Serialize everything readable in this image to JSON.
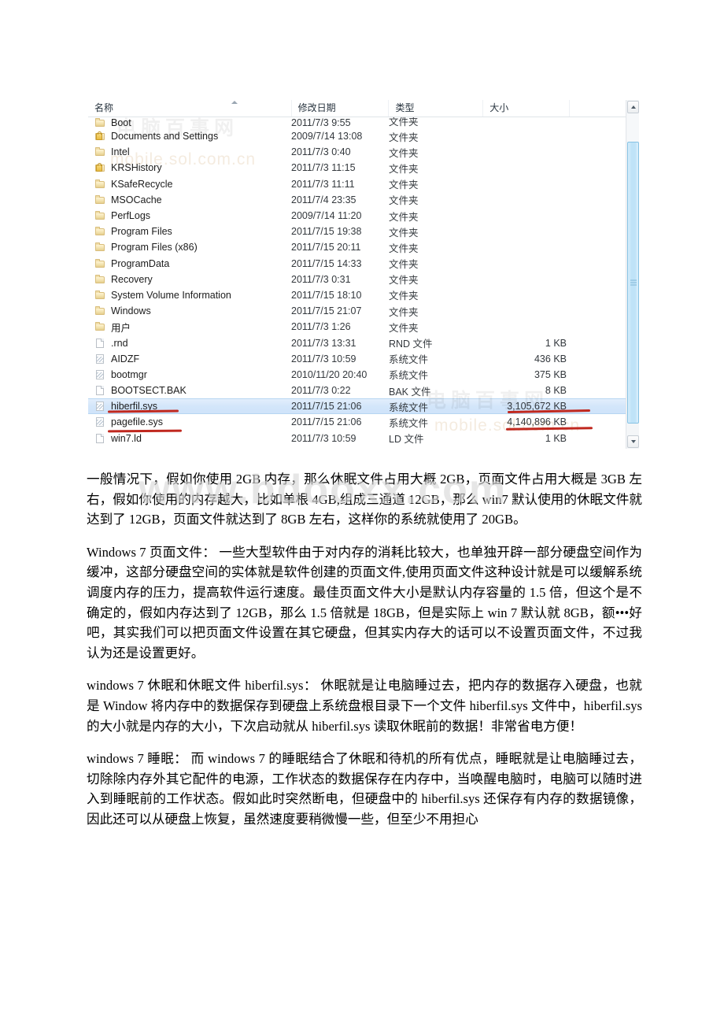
{
  "explorer": {
    "columns": [
      {
        "key": "name",
        "label": "名称",
        "sorted": true
      },
      {
        "key": "date",
        "label": "修改日期"
      },
      {
        "key": "type",
        "label": "类型"
      },
      {
        "key": "size",
        "label": "大小"
      }
    ],
    "rows": [
      {
        "name": "Boot",
        "date": "2011/7/3 9:55",
        "type": "文件夹",
        "size": "",
        "icon": "folder-icon",
        "clipped": true
      },
      {
        "name": "Documents and Settings",
        "date": "2009/7/14 13:08",
        "type": "文件夹",
        "size": "",
        "icon": "folder-locked-icon"
      },
      {
        "name": "Intel",
        "date": "2011/7/3 0:40",
        "type": "文件夹",
        "size": "",
        "icon": "folder-icon"
      },
      {
        "name": "KRSHistory",
        "date": "2011/7/3 11:15",
        "type": "文件夹",
        "size": "",
        "icon": "folder-locked-icon"
      },
      {
        "name": "KSafeRecycle",
        "date": "2011/7/3 11:11",
        "type": "文件夹",
        "size": "",
        "icon": "folder-icon"
      },
      {
        "name": "MSOCache",
        "date": "2011/7/4 23:35",
        "type": "文件夹",
        "size": "",
        "icon": "folder-icon"
      },
      {
        "name": "PerfLogs",
        "date": "2009/7/14 11:20",
        "type": "文件夹",
        "size": "",
        "icon": "folder-icon"
      },
      {
        "name": "Program Files",
        "date": "2011/7/15 19:38",
        "type": "文件夹",
        "size": "",
        "icon": "folder-icon"
      },
      {
        "name": "Program Files (x86)",
        "date": "2011/7/15 20:11",
        "type": "文件夹",
        "size": "",
        "icon": "folder-icon"
      },
      {
        "name": "ProgramData",
        "date": "2011/7/15 14:33",
        "type": "文件夹",
        "size": "",
        "icon": "folder-icon"
      },
      {
        "name": "Recovery",
        "date": "2011/7/3 0:31",
        "type": "文件夹",
        "size": "",
        "icon": "folder-icon"
      },
      {
        "name": "System Volume Information",
        "date": "2011/7/15 18:10",
        "type": "文件夹",
        "size": "",
        "icon": "folder-icon"
      },
      {
        "name": "Windows",
        "date": "2011/7/15 21:07",
        "type": "文件夹",
        "size": "",
        "icon": "folder-icon"
      },
      {
        "name": "用户",
        "date": "2011/7/3 1:26",
        "type": "文件夹",
        "size": "",
        "icon": "folder-icon"
      },
      {
        "name": ".rnd",
        "date": "2011/7/3 13:31",
        "type": "RND 文件",
        "size": "1 KB",
        "icon": "document-icon"
      },
      {
        "name": "AIDZF",
        "date": "2011/7/3 10:59",
        "type": "系统文件",
        "size": "436 KB",
        "icon": "system-file-icon"
      },
      {
        "name": "bootmgr",
        "date": "2010/11/20 20:40",
        "type": "系统文件",
        "size": "375 KB",
        "icon": "system-file-icon"
      },
      {
        "name": "BOOTSECT.BAK",
        "date": "2011/7/3 0:22",
        "type": "BAK 文件",
        "size": "8 KB",
        "icon": "document-icon"
      },
      {
        "name": "hiberfil.sys",
        "date": "2011/7/15 21:06",
        "type": "系统文件",
        "size": "3,105,672 KB",
        "icon": "system-file-icon",
        "selected": true,
        "underlined_name": true,
        "underlined_size": true
      },
      {
        "name": "pagefile.sys",
        "date": "2011/7/15 21:06",
        "type": "系统文件",
        "size": "4,140,896 KB",
        "icon": "system-file-icon",
        "underlined_name": true,
        "underlined_size": true
      },
      {
        "name": "win7.ld",
        "date": "2011/7/3 10:59",
        "type": "LD 文件",
        "size": "1 KB",
        "icon": "document-icon"
      }
    ],
    "scrollbar": {
      "up_arrow": "scroll-up-arrow-icon",
      "down_arrow": "scroll-down-arrow-icon"
    },
    "watermarks": {
      "cn": "电脑百事网",
      "url": "mobile.sol.com.cn",
      "url2": "mobile.sol.com.cn"
    }
  },
  "page_watermark": "www.bdooxx.com",
  "body": {
    "paragraphs": [
      "一般情况下，假如你使用 2GB 内存，那么休眠文件占用大概 2GB，页面文件占用大概是 3GB 左右，假如你使用的内存越大，比如单根 4GB,组成三通道 12GB，那么 win7 默认使用的休眠文件就达到了 12GB，页面文件就达到了 8GB 左右，这样你的系统就使用了 20GB。",
      "Windows 7 页面文件：\n一些大型软件由于对内存的消耗比较大，也单独开辟一部分硬盘空间作为缓冲，这部分硬盘空间的实体就是软件创建的页面文件,使用页面文件这种设计就是可以缓解系统调度内存的压力，提高软件运行速度。最佳页面文件大小是默认内存容量的 1.5 倍，但这个是不确定的，假如内存达到了 12GB，那么 1.5 倍就是 18GB，但是实际上 win 7 默认就 8GB，额•••好吧，其实我们可以把页面文件设置在其它硬盘，但其实内存大的话可以不设置页面文件，不过我认为还是设置更好。",
      "windows 7 休眠和休眠文件 hiberfil.sys：\n休眠就是让电脑睡过去，把内存的数据存入硬盘，也就是 Window 将内存中的数据保存到硬盘上系统盘根目录下一个文件 hiberfil.sys 文件中，hiberfil.sys 的大小就是内存的大小，下次启动就从 hiberfil.sys 读取休眠前的数据！非常省电方便！",
      "windows 7 睡眠：\n而 windows 7 的睡眠结合了休眠和待机的所有优点，睡眠就是让电脑睡过去，切除除内存外其它配件的电源，工作状态的数据保存在内存中，当唤醒电脑时，电脑可以随时进入到睡眠前的工作状态。假如此时突然断电，但硬盘中的 hiberfil.sys 还保存有内存的数据镜像，因此还可以从硬盘上恢复，虽然速度要稍微慢一些，但至少不用担心"
    ]
  },
  "colors": {
    "selection": "#cfe3fa",
    "selection_border": "#b7d6f2",
    "annotation_red": "#c0281f",
    "scrollbar_thumb": "#bfe3f8",
    "folder_yellow": "#f3e3b0"
  }
}
